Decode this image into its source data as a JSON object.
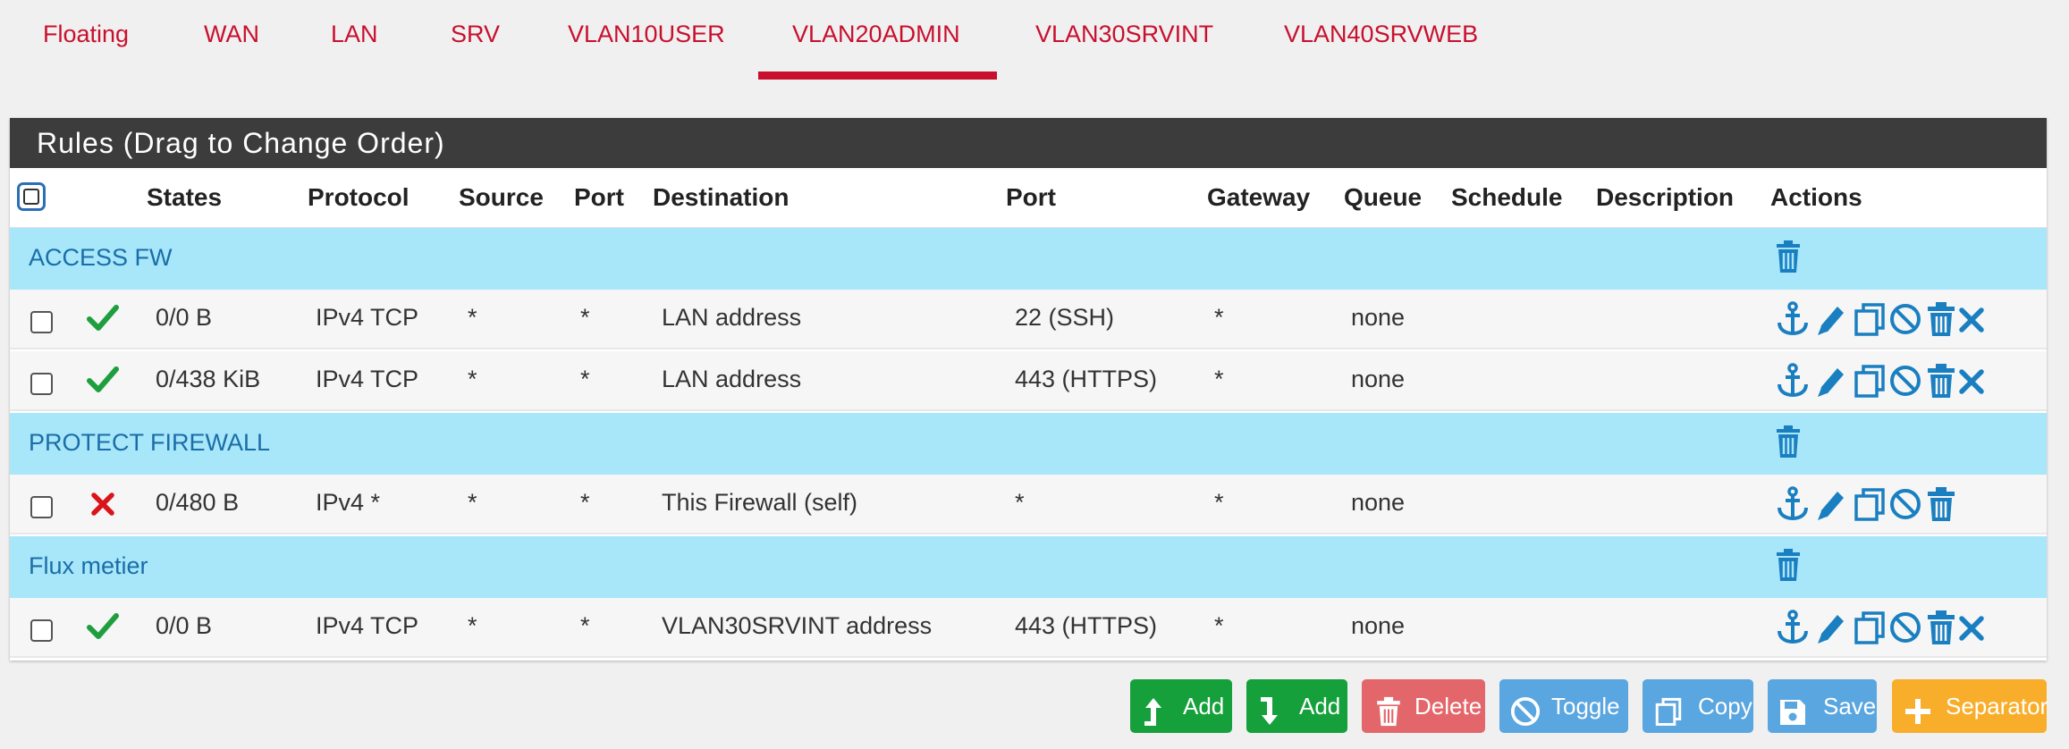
{
  "tabs": [
    {
      "label": "Floating"
    },
    {
      "label": "WAN"
    },
    {
      "label": "LAN"
    },
    {
      "label": "SRV"
    },
    {
      "label": "VLAN10USER"
    },
    {
      "label": "VLAN20ADMIN",
      "active": true
    },
    {
      "label": "VLAN30SRVINT"
    },
    {
      "label": "VLAN40SRVWEB"
    }
  ],
  "panel": {
    "title": "Rules (Drag to Change Order)"
  },
  "columns": {
    "states": "States",
    "protocol": "Protocol",
    "source": "Source",
    "port": "Port",
    "destination": "Destination",
    "dport": "Port",
    "gateway": "Gateway",
    "queue": "Queue",
    "schedule": "Schedule",
    "description": "Description",
    "actions": "Actions"
  },
  "separators": [
    {
      "label": "ACCESS FW"
    },
    {
      "label": "PROTECT FIREWALL"
    },
    {
      "label": "Flux metier"
    }
  ],
  "rules": [
    {
      "status": "pass",
      "states": "0/0 B",
      "protocol": "IPv4 TCP",
      "source": "*",
      "port": "*",
      "destination": "LAN address",
      "dport": "22 (SSH)",
      "gateway": "*",
      "queue": "none",
      "schedule": "",
      "description": ""
    },
    {
      "status": "pass",
      "states": "0/438 KiB",
      "protocol": "IPv4 TCP",
      "source": "*",
      "port": "*",
      "destination": "LAN address",
      "dport": "443 (HTTPS)",
      "gateway": "*",
      "queue": "none",
      "schedule": "",
      "description": ""
    },
    {
      "status": "block",
      "states": "0/480 B",
      "protocol": "IPv4 *",
      "source": "*",
      "port": "*",
      "destination": "This Firewall (self)",
      "dport": "*",
      "gateway": "*",
      "queue": "none",
      "schedule": "",
      "description": ""
    },
    {
      "status": "pass",
      "states": "0/0 B",
      "protocol": "IPv4 TCP",
      "source": "*",
      "port": "*",
      "destination": "VLAN30SRVINT address",
      "dport": "443 (HTTPS)",
      "gateway": "*",
      "queue": "none",
      "schedule": "",
      "description": ""
    }
  ],
  "buttons": {
    "add_top": "Add",
    "add_bottom": "Add",
    "delete": "Delete",
    "toggle": "Toggle",
    "copy": "Copy",
    "save": "Save",
    "separator": "Separator"
  },
  "colors": {
    "tab_active": "#c8102e",
    "separator_bg": "#a8e6fa",
    "pass": "#1e9e3e",
    "block": "#d9141b",
    "link": "#1a7fc1",
    "btn_add": "#16a03c",
    "btn_delete": "#e3676a",
    "btn_toggle": "#5aa6e0",
    "btn_copy": "#5aa6e0",
    "btn_save": "#5aa6e0",
    "btn_separator": "#f8ae2b"
  },
  "icons": [
    "check-icon",
    "block-x-icon",
    "anchor-icon",
    "pencil-icon",
    "copy-icon",
    "disable-icon",
    "trash-icon",
    "remove-x-icon",
    "floppy-icon",
    "plus-icon",
    "arrow-up-icon",
    "arrow-down-icon"
  ]
}
